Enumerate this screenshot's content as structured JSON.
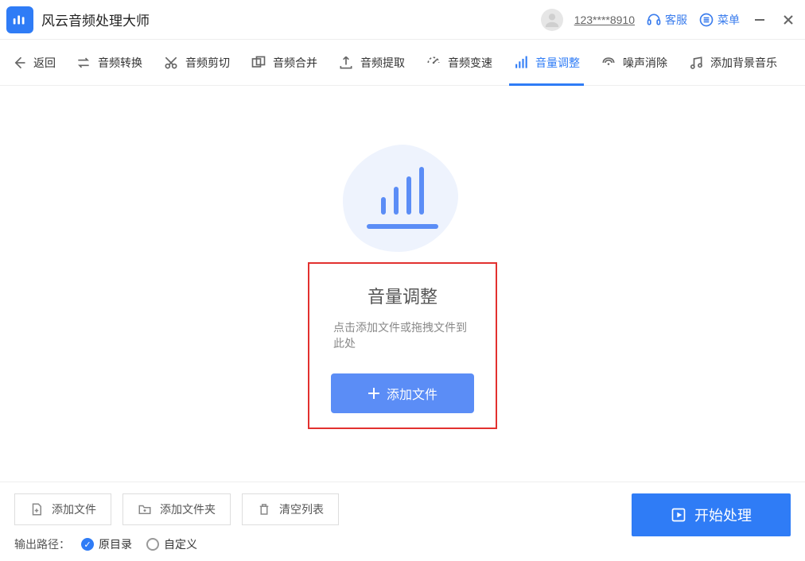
{
  "app": {
    "title": "风云音频处理大师"
  },
  "titlebar": {
    "user_id": "123****8910",
    "support": "客服",
    "menu": "菜单"
  },
  "toolbar": {
    "back": "返回",
    "convert": "音频转换",
    "cut": "音频剪切",
    "merge": "音频合并",
    "extract": "音频提取",
    "speed": "音频变速",
    "volume": "音量调整",
    "denoise": "噪声消除",
    "bgm": "添加背景音乐"
  },
  "hero": {
    "title": "音量调整",
    "subtitle": "点击添加文件或拖拽文件到此处",
    "add_button": "添加文件"
  },
  "footer": {
    "add_file": "添加文件",
    "add_folder": "添加文件夹",
    "clear_list": "清空列表",
    "output_label": "输出路径：",
    "radio_original": "原目录",
    "radio_custom": "自定义",
    "start": "开始处理"
  }
}
